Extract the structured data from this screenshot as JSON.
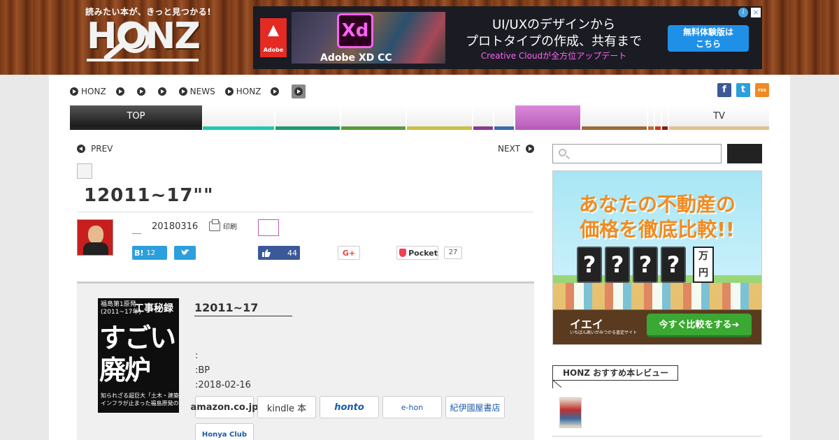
{
  "header": {
    "tagline": "読みたい本が、きっと見つかる!",
    "logo": "HONZ"
  },
  "ad_banner": {
    "adobe_label": "Adobe",
    "xd_mark": "Xd",
    "product": "Adobe XD CC",
    "headline1": "UI/UXのデザインから",
    "headline2": "プロトタイプの作成、共有まで",
    "sub": "Creative Cloudが全方位アップデート",
    "cta_line1": "無料体験版は",
    "cta_line2": "こちら",
    "info_icon": "i",
    "close_icon": "×"
  },
  "subnav": {
    "items": [
      "HONZ",
      "",
      "",
      "",
      "NEWS",
      "HONZ",
      "",
      ""
    ]
  },
  "social": {
    "facebook": "f",
    "twitter": "t",
    "rss": "rss"
  },
  "gnav": {
    "top": "TOP",
    "tv": "TV",
    "colors": [
      "#222222",
      "#1ec8b0",
      "#1a9a70",
      "#5a9a3a",
      "#c8c040",
      "#8a3a8a",
      "#3a6aa8",
      "#b85cb8",
      "#9a6a3a",
      "#c86a2a",
      "#c83a1a",
      "#8a1a1a",
      "#e0c090"
    ]
  },
  "article": {
    "prev": "PREV",
    "next": "NEXT",
    "title": "12011~17\"\"",
    "author": "＿",
    "date": "20180316",
    "print": "印刷"
  },
  "share": {
    "hatena_label": "B!",
    "hatena_count": "12",
    "like_count": "44",
    "gplus": "G+",
    "pocket": "Pocket",
    "pocket_count": "27"
  },
  "book": {
    "cover_top": "福島第1原発\n(2011~17年)",
    "cover_series": "工事秘録",
    "cover_big1": "すごい",
    "cover_big2": "廃炉",
    "cover_small": "知られざる超巨大「土木・建築現場」\nインフラが止まった福島原発の記録",
    "title": "12011~17",
    "meta1": ":",
    "meta2": ":BP",
    "meta3": ":2018-02-16",
    "stores": [
      "amazon.co.jp",
      "kindle 本",
      "honto",
      "e-hon",
      "紀伊國屋書店",
      "Honya Club"
    ]
  },
  "sidebar": {
    "search_placeholder": "",
    "ad_line1": "あなたの不動産の",
    "ad_line2": "価格を徹底比較!!",
    "ad_digits": [
      "?",
      "?",
      "?",
      "?"
    ],
    "ad_unit": "万円",
    "ad_brand": "イエイ",
    "ad_brand_sub": "いちばん高いがみつかる査定サイト",
    "ad_cta": "今すぐ比較をする➔",
    "rec_title": "HONZ おすすめ本レビュー"
  }
}
